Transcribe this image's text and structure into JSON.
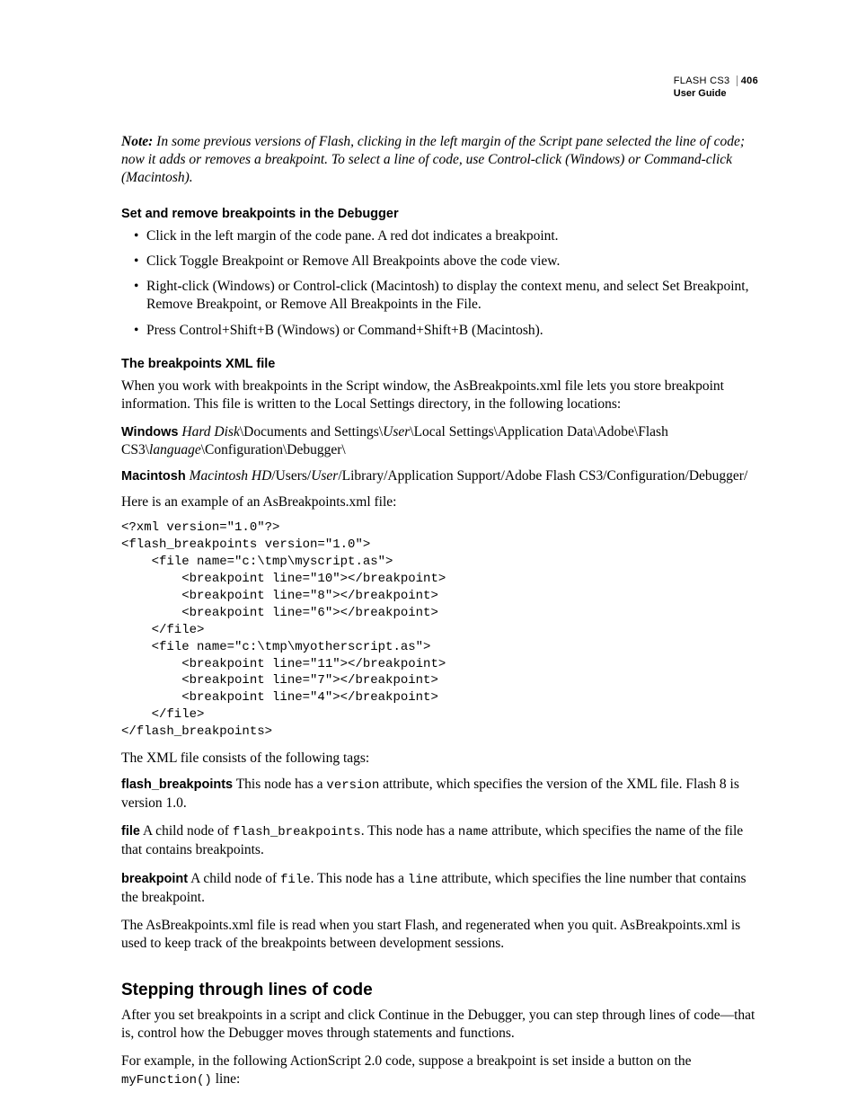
{
  "header": {
    "product": "FLASH CS3",
    "pagenum": "406",
    "sub": "User Guide"
  },
  "note": {
    "label": "Note:",
    "text": " In some previous versions of Flash, clicking in the left margin of the Script pane selected the line of code; now it adds or removes a breakpoint. To select a line of code, use Control-click (Windows) or Command-click (Macintosh)."
  },
  "h1": "Set and remove breakpoints in the Debugger",
  "bullets": [
    "Click in the left margin of the code pane. A red dot indicates a breakpoint.",
    "Click Toggle Breakpoint or Remove All Breakpoints above the code view.",
    "Right-click (Windows) or Control-click (Macintosh) to display the context menu, and select Set Breakpoint, Remove Breakpoint, or Remove All Breakpoints in the File.",
    "Press Control+Shift+B (Windows) or Command+Shift+B (Macintosh)."
  ],
  "h2": "The breakpoints XML file",
  "p_xml_intro": "When you work with breakpoints in the Script window, the AsBreakpoints.xml file lets you store breakpoint information. This file is written to the Local Settings directory, in the following locations:",
  "win": {
    "label": "Windows",
    "pre_hd": "  ",
    "hd": "Hard Disk",
    "mid1": "\\Documents and Settings\\",
    "user": "User",
    "mid2": "\\Local Settings\\Application Data\\Adobe\\Flash CS3\\",
    "lang": "language",
    "tail": "\\Configuration\\Debugger\\"
  },
  "mac": {
    "label": "Macintosh",
    "pre_hd": "  ",
    "hd": "Macintosh HD",
    "mid1": "/Users/",
    "user": "User",
    "tail": "/Library/Application Support/Adobe Flash CS3/Configuration/Debugger/"
  },
  "p_example": "Here is an example of an AsBreakpoints.xml file:",
  "code": "<?xml version=\"1.0\"?>\n<flash_breakpoints version=\"1.0\">\n    <file name=\"c:\\tmp\\myscript.as\">\n        <breakpoint line=\"10\"></breakpoint>\n        <breakpoint line=\"8\"></breakpoint>\n        <breakpoint line=\"6\"></breakpoint>\n    </file>\n    <file name=\"c:\\tmp\\myotherscript.as\">\n        <breakpoint line=\"11\"></breakpoint>\n        <breakpoint line=\"7\"></breakpoint>\n        <breakpoint line=\"4\"></breakpoint>\n    </file>\n</flash_breakpoints>",
  "p_consists": "The XML file consists of the following tags:",
  "fb": {
    "label": "flash_breakpoints",
    "t1": "  This node has a ",
    "c1": "version",
    "t2": " attribute, which specifies the version of the XML file. Flash 8 is version 1.0."
  },
  "file": {
    "label": "file",
    "t1": "  A child node of ",
    "c1": "flash_breakpoints",
    "t2": ". This node has a ",
    "c2": "name",
    "t3": " attribute, which specifies the name of the file that contains breakpoints."
  },
  "bp": {
    "label": "breakpoint",
    "t1": "  A child node of ",
    "c1": "file",
    "t2": ". This node has a ",
    "c2": "line",
    "t3": " attribute, which specifies the line number that contains the breakpoint."
  },
  "p_read": "The AsBreakpoints.xml file is read when you start Flash, and regenerated when you quit. AsBreakpoints.xml is used to keep track of the breakpoints between development sessions.",
  "h3": "Stepping through lines of code",
  "p_step1": "After you set breakpoints in a script and click Continue in the Debugger, you can step through lines of code—that is, control how the Debugger moves through statements and functions.",
  "p_step2a": "For example, in the following ActionScript 2.0 code, suppose a breakpoint is set inside a button on the ",
  "p_step2code": "myFunction()",
  "p_step2b": "  line:"
}
